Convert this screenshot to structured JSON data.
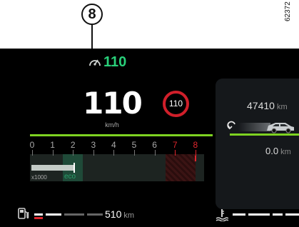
{
  "callout": {
    "number": "8",
    "reference_code": "62372"
  },
  "speed_limiter": {
    "icon": "speed-limiter-icon",
    "value": "110"
  },
  "speedometer": {
    "speed": "110",
    "unit": "km/h"
  },
  "speed_limit_sign": {
    "value": "110"
  },
  "tachometer": {
    "scale_labels": [
      "0",
      "1",
      "2",
      "3",
      "4",
      "5",
      "6",
      "7",
      "8"
    ],
    "redline_from": 7,
    "rpm_fraction": 0.24,
    "multiplier_label": "x1000",
    "eco_label": "eco"
  },
  "fuel": {
    "icon": "fuel-pump-icon",
    "level": 0.45,
    "range": "510",
    "unit": "km"
  },
  "coolant": {
    "icon": "coolant-temperature-icon"
  },
  "odometer": {
    "value": "47410",
    "unit": "km"
  },
  "trip": {
    "value": "0.0",
    "unit": "km",
    "icon": "reset-icon"
  },
  "colors": {
    "accent_green": "#7ed321",
    "limiter_green": "#29d07a",
    "redline": "#e0262d",
    "sign_red": "#d01f2a"
  }
}
